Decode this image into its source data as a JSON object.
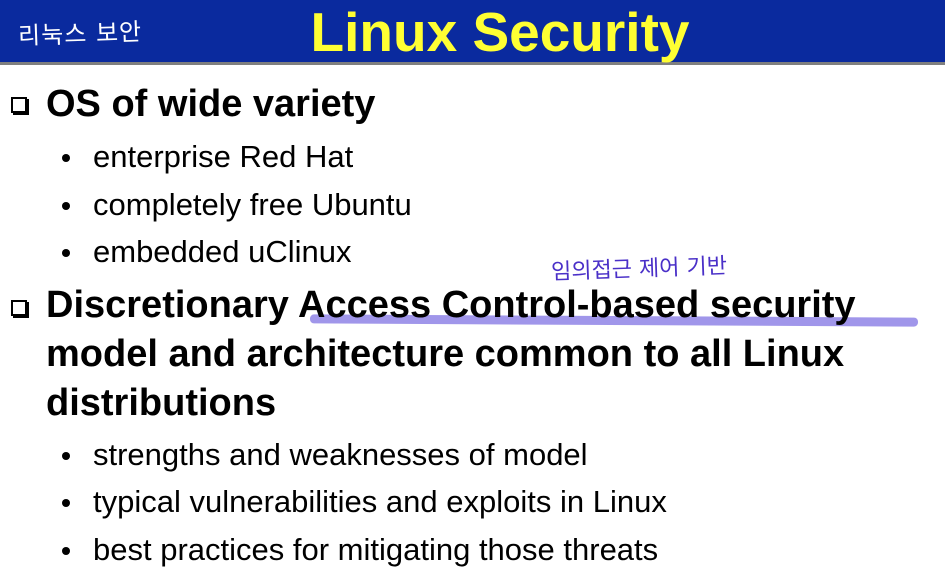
{
  "header": {
    "note": "리눅스 보안",
    "title": "Linux Security"
  },
  "bullets": [
    {
      "text": "OS of wide variety",
      "sub": [
        "enterprise Red Hat",
        "completely free Ubuntu",
        "embedded uClinux"
      ]
    },
    {
      "text_line1": "Discretionary Access Control-based security",
      "text_line2": "model and architecture common to all Linux",
      "text_line3": "distributions",
      "sub": [
        "strengths and weaknesses of model",
        "typical vulnerabilities and exploits in Linux",
        "best practices for mitigating those threats"
      ]
    }
  ],
  "annotation": {
    "note": "임의접근 제어 기반",
    "highlight_color": "#8f84e6",
    "note_color": "#4a30c8"
  },
  "colors": {
    "title_bar": "#0a2a9e",
    "title_text": "#ffff33"
  }
}
